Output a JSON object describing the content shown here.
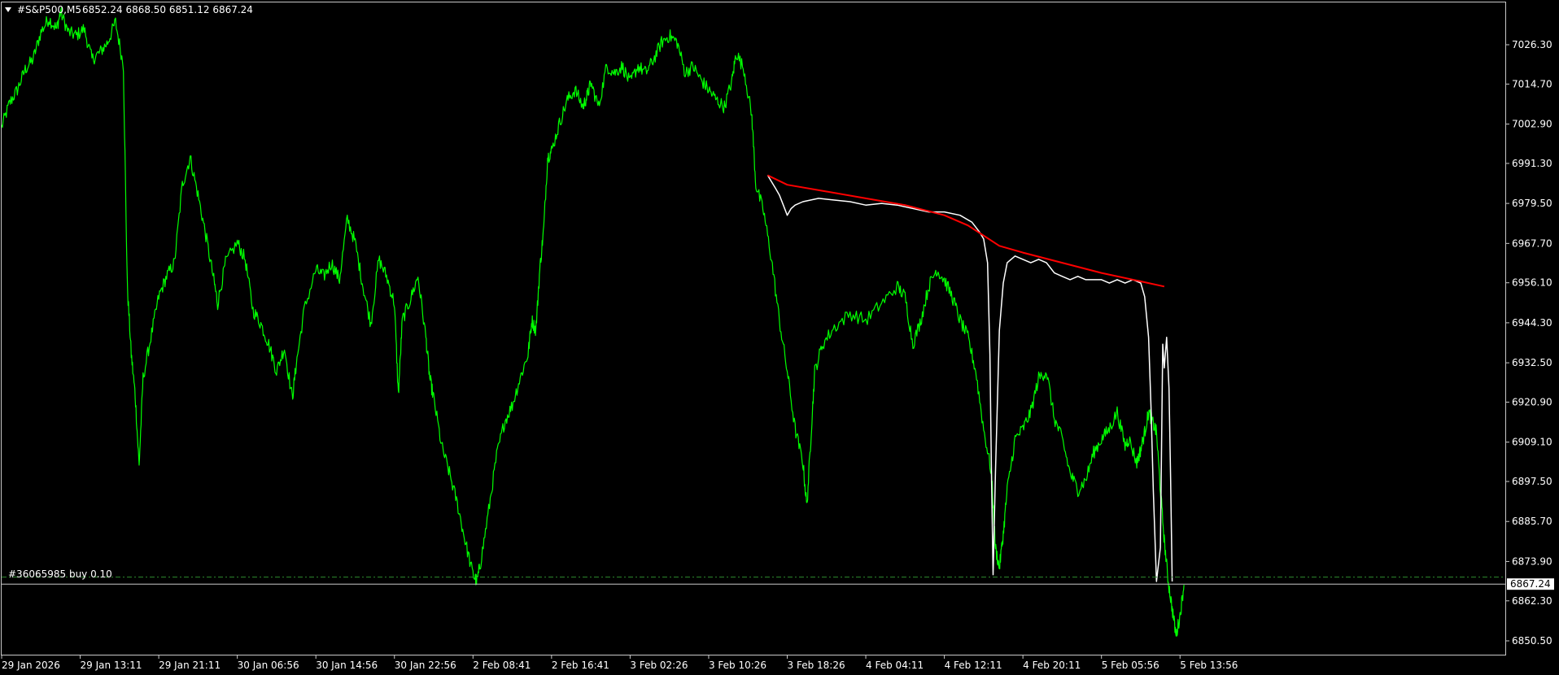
{
  "header": {
    "symbol": "#S&P500,M5",
    "ohlc": "6852.24 6868.50 6851.12 6867.24"
  },
  "order_line": {
    "label": "#36065985 buy 0.10",
    "price": 6869.3,
    "color": "#2e8b2e"
  },
  "current_price": {
    "label": "6867.24",
    "value": 6867.24
  },
  "colors": {
    "background": "#000000",
    "frame": "#c8c8c8",
    "price_series": "#00ff00",
    "overlay_series": "#ffffff",
    "trend_series": "#ff0000",
    "text": "#ffffff"
  },
  "chart_data": {
    "type": "line",
    "title": "",
    "xlabel": "",
    "ylabel": "",
    "ylim": [
      6846.6,
      7038.0
    ],
    "y_ticks": [
      "7026.30",
      "7014.70",
      "7002.90",
      "6991.30",
      "6979.50",
      "6967.70",
      "6956.10",
      "6944.30",
      "6932.50",
      "6920.90",
      "6909.10",
      "6897.50",
      "6885.70",
      "6873.90",
      "6862.30",
      "6850.50"
    ],
    "x_ticks": [
      "29 Jan 2026",
      "29 Jan 13:11",
      "29 Jan 21:11",
      "30 Jan 06:56",
      "30 Jan 14:56",
      "30 Jan 22:56",
      "2 Feb 08:41",
      "2 Feb 16:41",
      "3 Feb 02:26",
      "3 Feb 10:26",
      "3 Feb 18:26",
      "4 Feb 04:11",
      "4 Feb 12:11",
      "4 Feb 20:11",
      "5 Feb 05:56",
      "5 Feb 13:56"
    ],
    "grid": false,
    "legend": "none",
    "x_index_range": [
      0,
      15.4
    ],
    "series": [
      {
        "color": "#00ff00",
        "points": [
          [
            0.0,
            7002
          ],
          [
            0.1,
            7009
          ],
          [
            0.2,
            7013
          ],
          [
            0.3,
            7019
          ],
          [
            0.4,
            7022
          ],
          [
            0.5,
            7030
          ],
          [
            0.6,
            7034
          ],
          [
            0.7,
            7031
          ],
          [
            0.75,
            7036
          ],
          [
            0.85,
            7030
          ],
          [
            0.95,
            7029
          ],
          [
            1.05,
            7031
          ],
          [
            1.15,
            7022
          ],
          [
            1.25,
            7024
          ],
          [
            1.35,
            7027
          ],
          [
            1.45,
            7033
          ],
          [
            1.55,
            7020
          ],
          [
            1.6,
            6955
          ],
          [
            1.65,
            6935
          ],
          [
            1.7,
            6923
          ],
          [
            1.75,
            6902
          ],
          [
            1.8,
            6928
          ],
          [
            1.9,
            6940
          ],
          [
            2.0,
            6952
          ],
          [
            2.1,
            6958
          ],
          [
            2.2,
            6962
          ],
          [
            2.3,
            6985
          ],
          [
            2.4,
            6993
          ],
          [
            2.5,
            6982
          ],
          [
            2.6,
            6970
          ],
          [
            2.7,
            6957
          ],
          [
            2.75,
            6950
          ],
          [
            2.85,
            6962
          ],
          [
            3.0,
            6968
          ],
          [
            3.1,
            6963
          ],
          [
            3.2,
            6948
          ],
          [
            3.3,
            6944
          ],
          [
            3.4,
            6938
          ],
          [
            3.5,
            6930
          ],
          [
            3.6,
            6937
          ],
          [
            3.7,
            6922
          ],
          [
            3.75,
            6932
          ],
          [
            3.85,
            6948
          ],
          [
            4.0,
            6960
          ],
          [
            4.1,
            6958
          ],
          [
            4.2,
            6962
          ],
          [
            4.3,
            6957
          ],
          [
            4.4,
            6975
          ],
          [
            4.5,
            6968
          ],
          [
            4.6,
            6955
          ],
          [
            4.7,
            6944
          ],
          [
            4.8,
            6963
          ],
          [
            4.9,
            6958
          ],
          [
            5.0,
            6950
          ],
          [
            5.05,
            6923
          ],
          [
            5.1,
            6945
          ],
          [
            5.2,
            6951
          ],
          [
            5.3,
            6958
          ],
          [
            5.4,
            6940
          ],
          [
            5.45,
            6928
          ],
          [
            5.5,
            6922
          ],
          [
            5.6,
            6908
          ],
          [
            5.7,
            6900
          ],
          [
            5.8,
            6891
          ],
          [
            5.9,
            6880
          ],
          [
            6.0,
            6870
          ],
          [
            6.05,
            6868
          ],
          [
            6.1,
            6874
          ],
          [
            6.2,
            6889
          ],
          [
            6.3,
            6905
          ],
          [
            6.4,
            6915
          ],
          [
            6.5,
            6920
          ],
          [
            6.6,
            6928
          ],
          [
            6.7,
            6935
          ],
          [
            6.75,
            6945
          ],
          [
            6.8,
            6942
          ],
          [
            6.85,
            6960
          ],
          [
            6.9,
            6972
          ],
          [
            6.95,
            6993
          ],
          [
            7.0,
            6995
          ],
          [
            7.1,
            7003
          ],
          [
            7.2,
            7010
          ],
          [
            7.3,
            7013
          ],
          [
            7.4,
            7008
          ],
          [
            7.45,
            7011
          ],
          [
            7.5,
            7015
          ],
          [
            7.6,
            7008
          ],
          [
            7.7,
            7020
          ],
          [
            7.8,
            7018
          ],
          [
            7.9,
            7020
          ],
          [
            8.0,
            7015
          ],
          [
            8.1,
            7020
          ],
          [
            8.2,
            7018
          ],
          [
            8.3,
            7022
          ],
          [
            8.4,
            7027
          ],
          [
            8.5,
            7029
          ],
          [
            8.6,
            7027
          ],
          [
            8.7,
            7018
          ],
          [
            8.8,
            7020
          ],
          [
            8.9,
            7016
          ],
          [
            9.0,
            7013
          ],
          [
            9.1,
            7010
          ],
          [
            9.2,
            7008
          ],
          [
            9.3,
            7016
          ],
          [
            9.35,
            7024
          ],
          [
            9.45,
            7019
          ],
          [
            9.55,
            7005
          ],
          [
            9.6,
            6985
          ],
          [
            9.7,
            6977
          ],
          [
            9.8,
            6963
          ],
          [
            9.9,
            6945
          ],
          [
            10.0,
            6930
          ],
          [
            10.1,
            6913
          ],
          [
            10.2,
            6903
          ],
          [
            10.25,
            6890
          ],
          [
            10.3,
            6910
          ],
          [
            10.35,
            6930
          ],
          [
            10.45,
            6938
          ],
          [
            10.6,
            6943
          ],
          [
            10.8,
            6947
          ],
          [
            11.0,
            6945
          ],
          [
            11.2,
            6950
          ],
          [
            11.4,
            6955
          ],
          [
            11.5,
            6952
          ],
          [
            11.6,
            6938
          ],
          [
            11.7,
            6945
          ],
          [
            11.8,
            6955
          ],
          [
            11.9,
            6960
          ],
          [
            12.0,
            6957
          ],
          [
            12.1,
            6952
          ],
          [
            12.2,
            6945
          ],
          [
            12.3,
            6940
          ],
          [
            12.4,
            6930
          ],
          [
            12.5,
            6913
          ],
          [
            12.6,
            6900
          ],
          [
            12.65,
            6878
          ],
          [
            12.7,
            6872
          ],
          [
            12.75,
            6882
          ],
          [
            12.8,
            6895
          ],
          [
            12.9,
            6910
          ],
          [
            13.0,
            6913
          ],
          [
            13.1,
            6918
          ],
          [
            13.2,
            6928
          ],
          [
            13.3,
            6930
          ],
          [
            13.4,
            6916
          ],
          [
            13.5,
            6910
          ],
          [
            13.6,
            6900
          ],
          [
            13.7,
            6895
          ],
          [
            13.8,
            6898
          ],
          [
            13.9,
            6906
          ],
          [
            14.0,
            6910
          ],
          [
            14.1,
            6913
          ],
          [
            14.2,
            6918
          ],
          [
            14.3,
            6908
          ],
          [
            14.35,
            6910
          ],
          [
            14.45,
            6903
          ],
          [
            14.5,
            6907
          ],
          [
            14.55,
            6912
          ],
          [
            14.6,
            6918
          ],
          [
            14.65,
            6915
          ],
          [
            14.7,
            6912
          ],
          [
            14.75,
            6895
          ],
          [
            14.8,
            6880
          ],
          [
            14.85,
            6868
          ],
          [
            14.9,
            6860
          ],
          [
            14.95,
            6852
          ],
          [
            15.0,
            6858
          ],
          [
            15.05,
            6867
          ]
        ]
      },
      {
        "color": "#ffffff",
        "points": [
          [
            9.75,
            6987.8
          ],
          [
            9.85,
            6984
          ],
          [
            9.9,
            6982
          ],
          [
            9.95,
            6979
          ],
          [
            10.0,
            6976
          ],
          [
            10.05,
            6978
          ],
          [
            10.1,
            6979
          ],
          [
            10.2,
            6980
          ],
          [
            10.4,
            6981
          ],
          [
            10.6,
            6980.5
          ],
          [
            10.8,
            6980
          ],
          [
            11.0,
            6979
          ],
          [
            11.2,
            6979.5
          ],
          [
            11.4,
            6979
          ],
          [
            11.6,
            6978
          ],
          [
            11.8,
            6977
          ],
          [
            12.0,
            6977
          ],
          [
            12.2,
            6976
          ],
          [
            12.35,
            6974
          ],
          [
            12.45,
            6971
          ],
          [
            12.5,
            6969
          ],
          [
            12.55,
            6962
          ],
          [
            12.58,
            6935
          ],
          [
            12.6,
            6900
          ],
          [
            12.62,
            6870
          ],
          [
            12.65,
            6900
          ],
          [
            12.7,
            6942
          ],
          [
            12.75,
            6956
          ],
          [
            12.8,
            6962
          ],
          [
            12.9,
            6964
          ],
          [
            13.0,
            6963
          ],
          [
            13.1,
            6962
          ],
          [
            13.2,
            6963
          ],
          [
            13.3,
            6962
          ],
          [
            13.4,
            6959
          ],
          [
            13.5,
            6958
          ],
          [
            13.6,
            6957
          ],
          [
            13.7,
            6958
          ],
          [
            13.8,
            6957
          ],
          [
            13.9,
            6957
          ],
          [
            14.0,
            6957
          ],
          [
            14.1,
            6956
          ],
          [
            14.2,
            6957
          ],
          [
            14.3,
            6956
          ],
          [
            14.4,
            6957
          ],
          [
            14.5,
            6956
          ],
          [
            14.55,
            6952
          ],
          [
            14.6,
            6940
          ],
          [
            14.63,
            6920
          ],
          [
            14.66,
            6895
          ],
          [
            14.7,
            6868
          ],
          [
            14.75,
            6878
          ],
          [
            14.78,
            6938
          ],
          [
            14.8,
            6931
          ],
          [
            14.83,
            6940
          ],
          [
            14.86,
            6925
          ],
          [
            14.88,
            6898
          ],
          [
            14.9,
            6868
          ]
        ]
      },
      {
        "color": "#ff0000",
        "points": [
          [
            9.75,
            6987.8
          ],
          [
            10.0,
            6985
          ],
          [
            10.5,
            6983
          ],
          [
            11.0,
            6981
          ],
          [
            11.5,
            6979
          ],
          [
            12.0,
            6976
          ],
          [
            12.3,
            6973
          ],
          [
            12.5,
            6970
          ],
          [
            12.7,
            6967
          ],
          [
            13.0,
            6965
          ],
          [
            13.5,
            6962
          ],
          [
            14.0,
            6959
          ],
          [
            14.5,
            6956.5
          ],
          [
            14.8,
            6955
          ]
        ]
      }
    ]
  }
}
